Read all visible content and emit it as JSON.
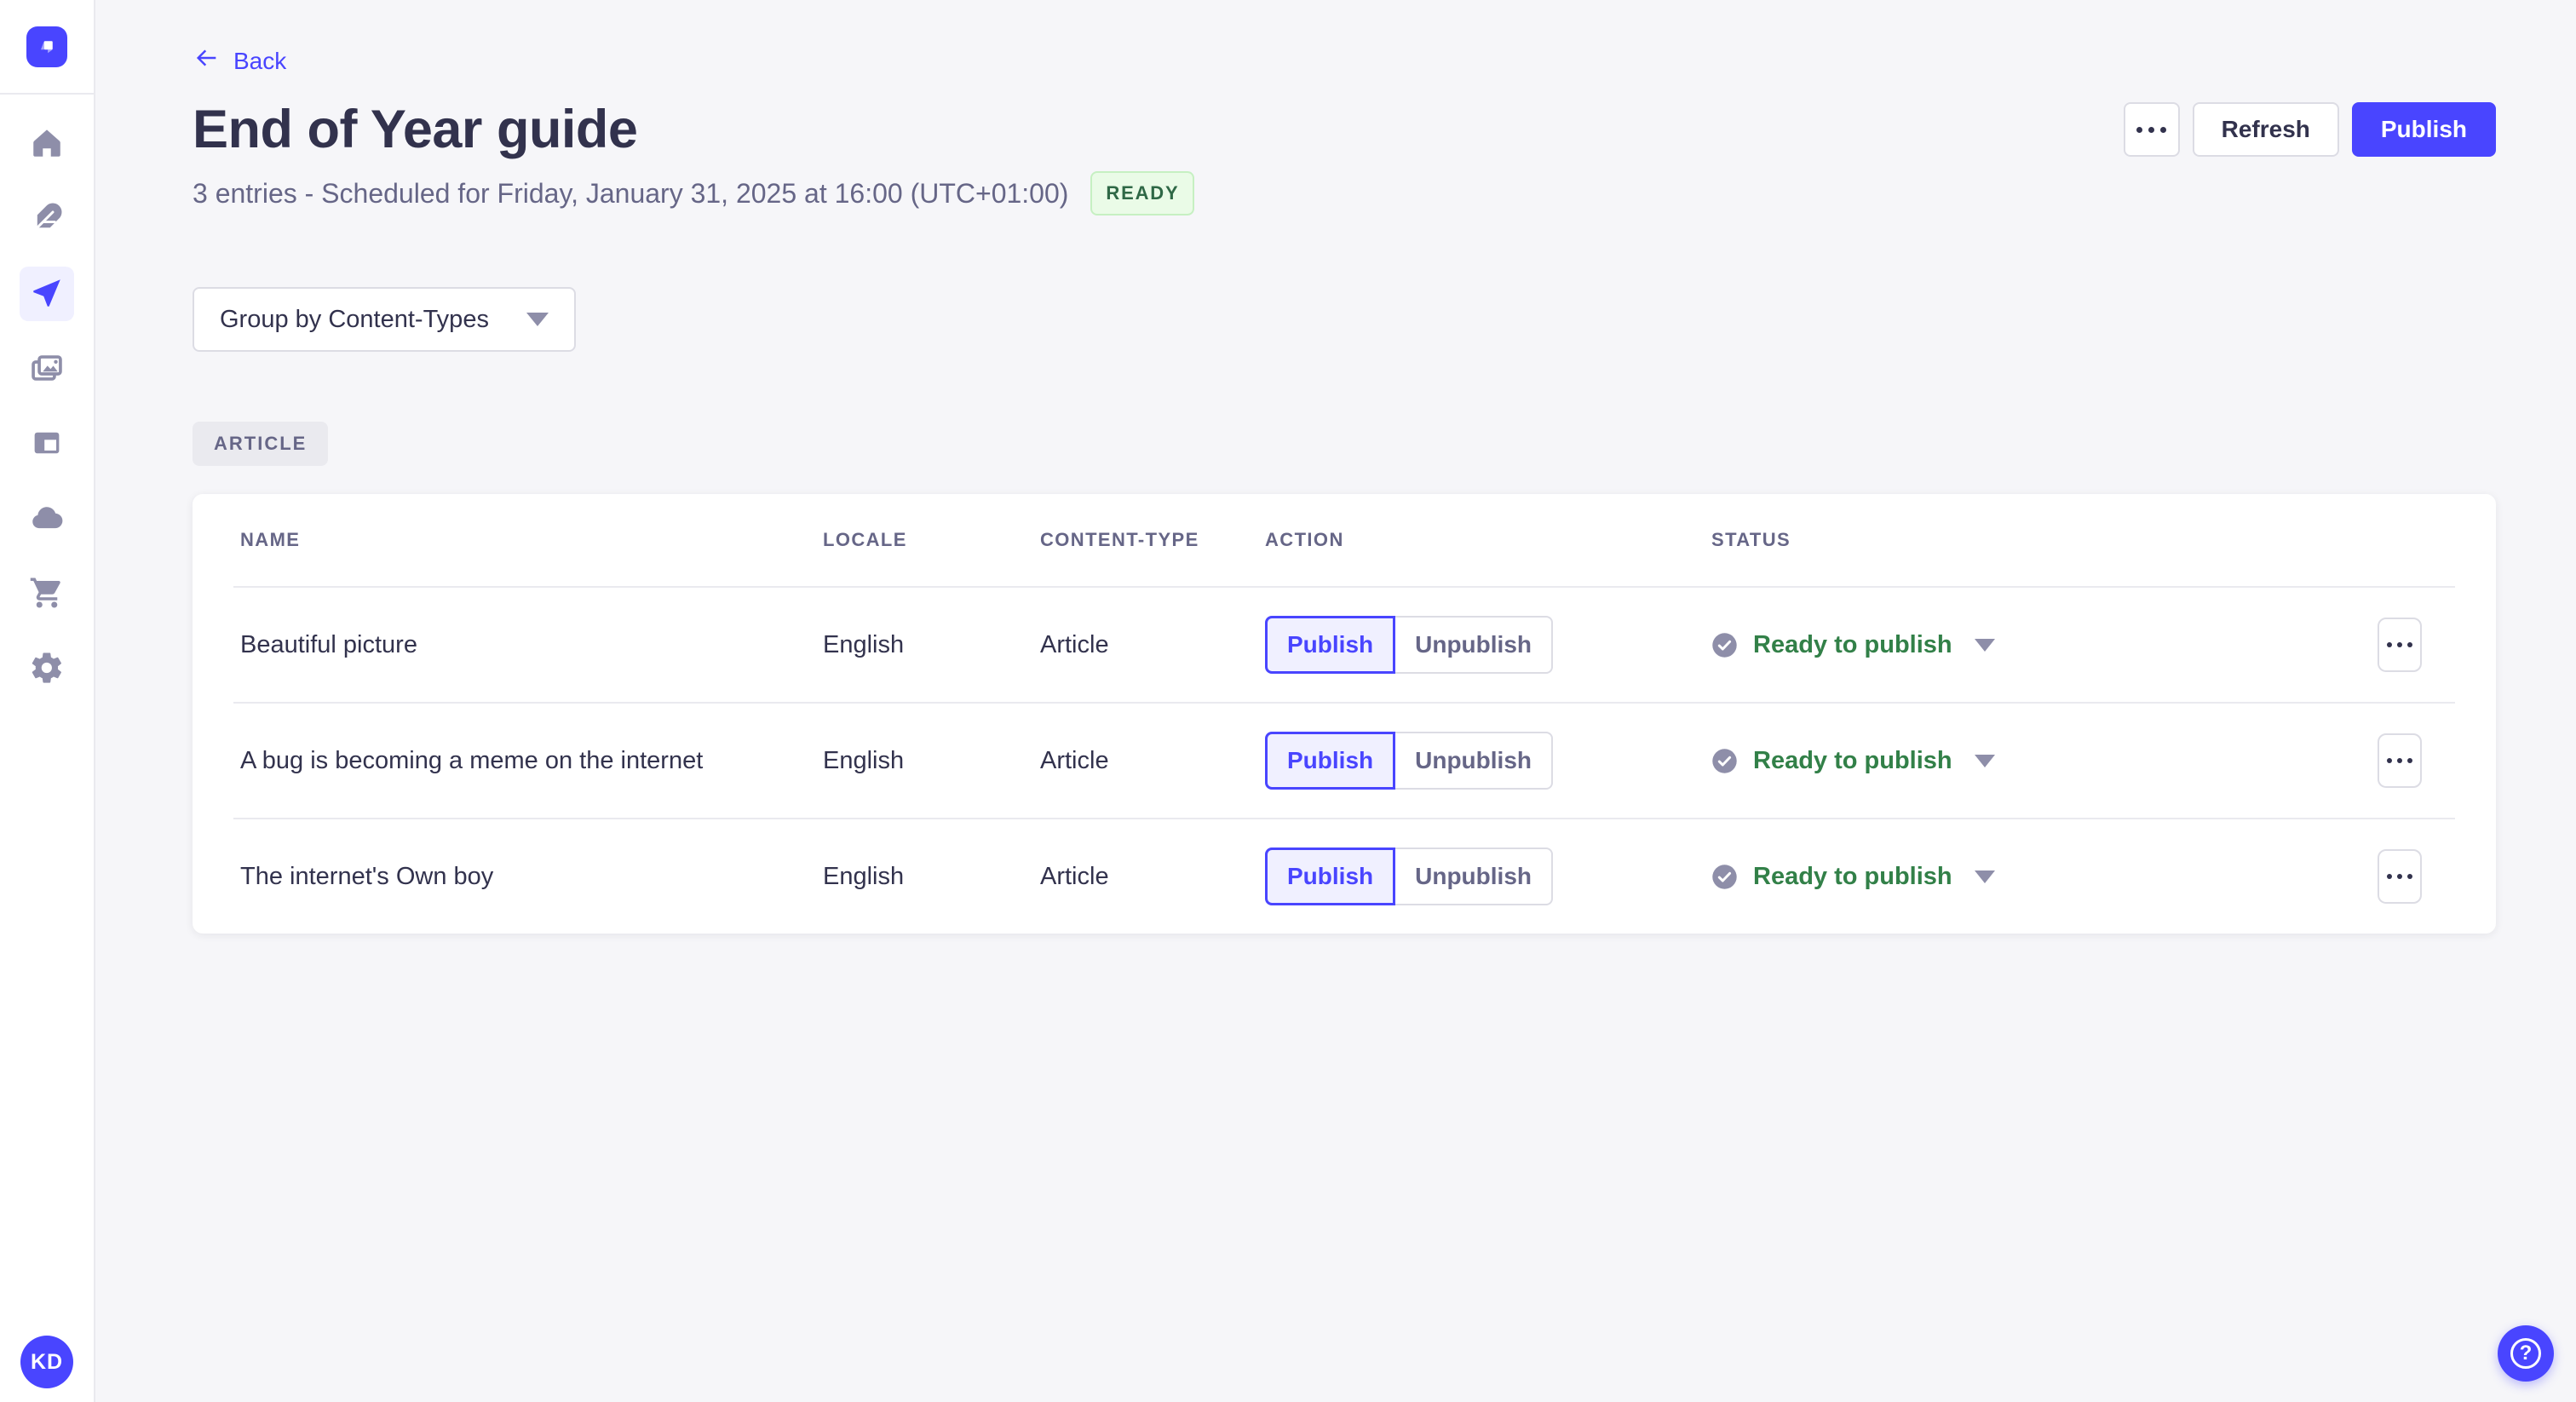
{
  "app": {
    "brand": "Strapi",
    "avatar_initials": "KD"
  },
  "sidebar": {
    "icons": [
      "strapi-logo",
      "home",
      "feather-pen",
      "paper-plane",
      "media-pictures",
      "layout-blocks",
      "cloud",
      "shopping-cart",
      "settings-gear"
    ],
    "active_item": "paper-plane"
  },
  "header": {
    "back_label": "Back",
    "title": "End of Year guide",
    "subtitle": "3 entries - Scheduled for Friday, January 31, 2025 at 16:00 (UTC+01:00)",
    "status_badge": "READY",
    "refresh_label": "Refresh",
    "publish_label": "Publish"
  },
  "filters": {
    "group_by_label": "Group by Content-Types"
  },
  "group": {
    "label": "ARTICLE"
  },
  "table": {
    "columns": [
      "NAME",
      "LOCALE",
      "CONTENT-TYPE",
      "ACTION",
      "STATUS"
    ],
    "rows": [
      {
        "name": "Beautiful picture",
        "locale": "English",
        "content_type": "Article",
        "publish": "Publish",
        "unpublish": "Unpublish",
        "status": "Ready to publish"
      },
      {
        "name": "A bug is becoming a meme on the internet",
        "locale": "English",
        "content_type": "Article",
        "publish": "Publish",
        "unpublish": "Unpublish",
        "status": "Ready to publish"
      },
      {
        "name": "The internet's Own boy",
        "locale": "English",
        "content_type": "Article",
        "publish": "Publish",
        "unpublish": "Unpublish",
        "status": "Ready to publish"
      }
    ]
  },
  "colors": {
    "primary": "#4945ff",
    "primary_light": "#f0f0ff",
    "success_text": "#328048",
    "badge_bg": "#eafbe7",
    "badge_border": "#c6f0c2",
    "neutral_icon": "#8e8ea9",
    "text": "#32324d",
    "muted": "#666687",
    "border": "#dcdce4",
    "background": "#f6f6f9"
  }
}
